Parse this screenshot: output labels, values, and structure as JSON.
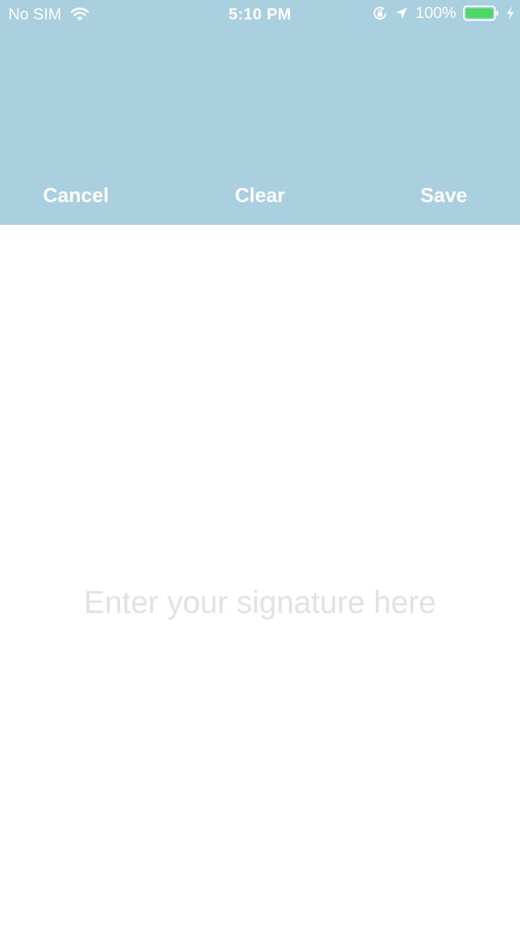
{
  "status_bar": {
    "carrier": "No SIM",
    "time": "5:10 PM",
    "battery_percent": "100%",
    "battery_level": 1.0,
    "icons": [
      "wifi-icon",
      "orientation-lock-icon",
      "location-arrow-icon",
      "battery-icon",
      "charging-bolt-icon"
    ]
  },
  "toolbar": {
    "cancel_label": "Cancel",
    "clear_label": "Clear",
    "save_label": "Save"
  },
  "signature_pad": {
    "placeholder": "Enter your signature here"
  },
  "colors": {
    "header_bg": "#aad0df",
    "toolbar_text": "#ffffff",
    "placeholder_text": "#e2e2e2",
    "battery_fill": "#4cd964"
  }
}
